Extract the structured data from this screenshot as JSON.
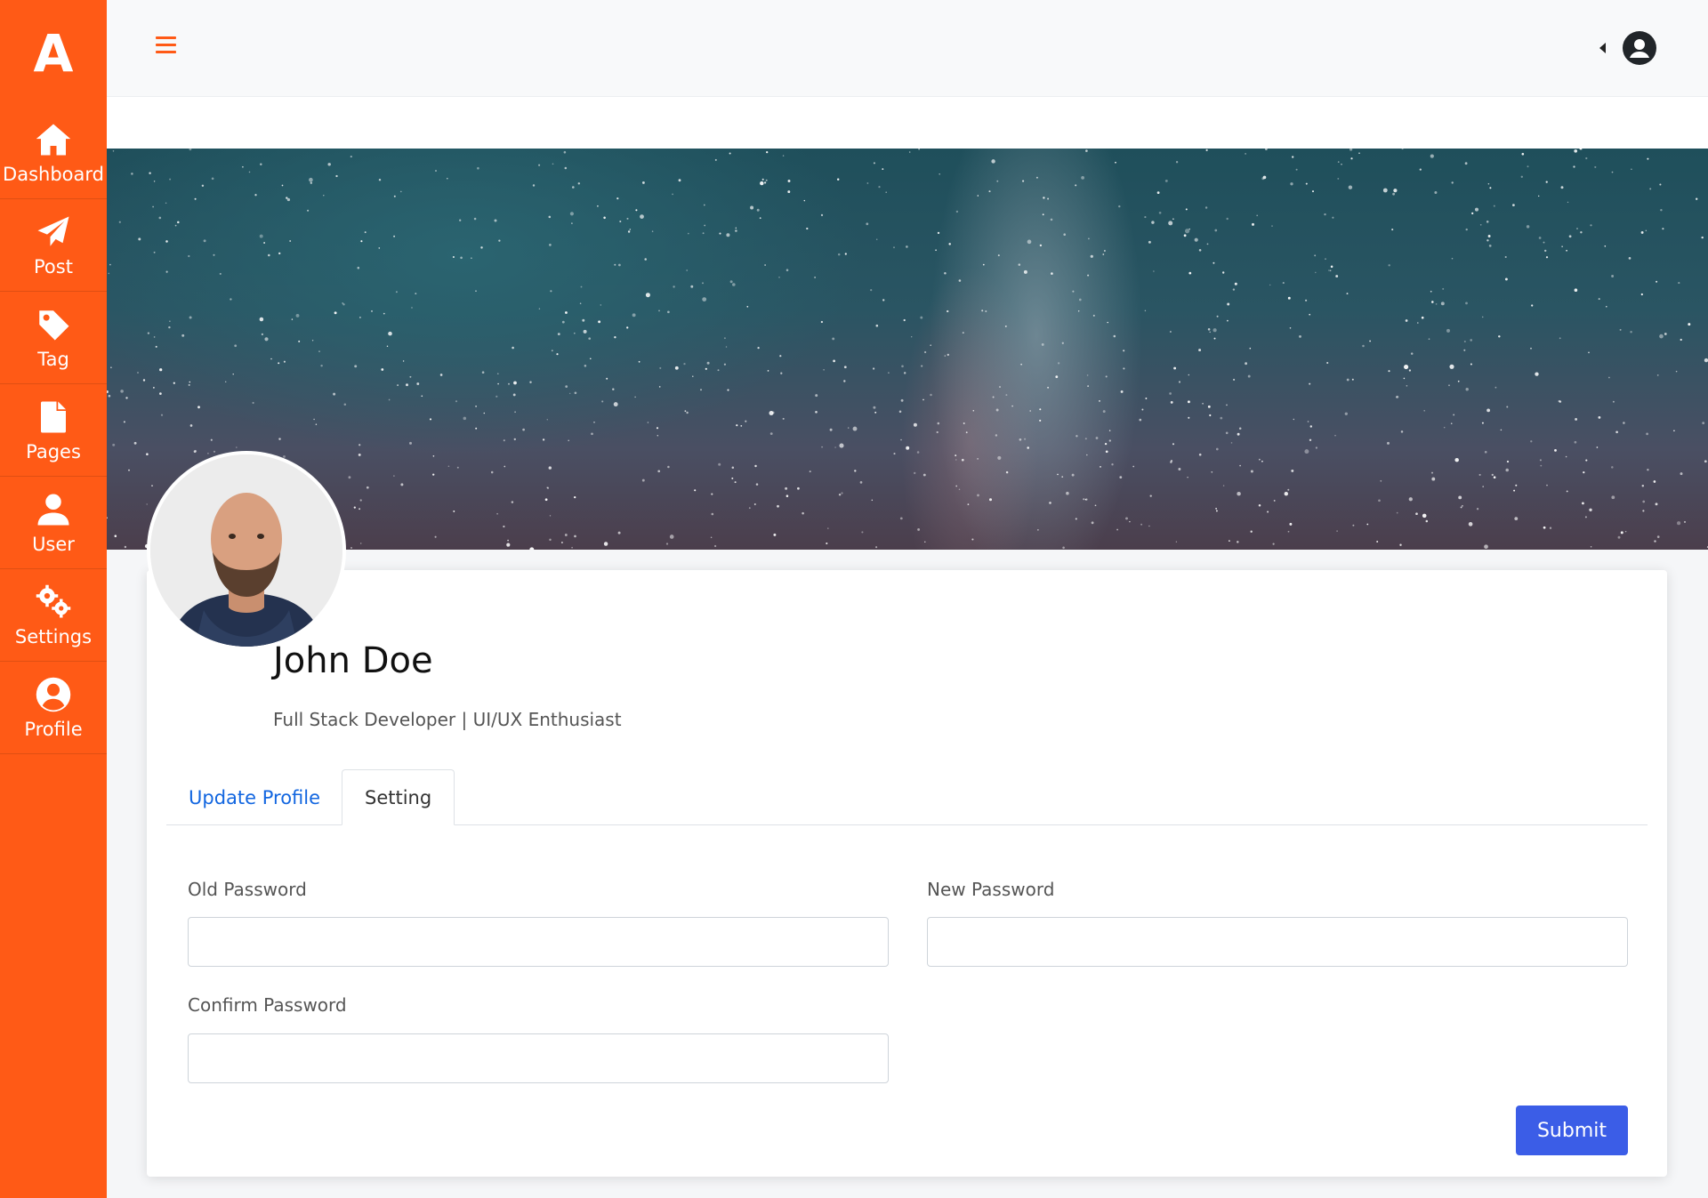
{
  "app": {
    "logo_letter": "A",
    "brand_color": "#ff5a16"
  },
  "sidebar": {
    "items": [
      {
        "label": "Dashboard",
        "icon": "home-icon"
      },
      {
        "label": "Post",
        "icon": "paper-plane-icon"
      },
      {
        "label": "Tag",
        "icon": "tag-icon"
      },
      {
        "label": "Pages",
        "icon": "file-icon"
      },
      {
        "label": "User",
        "icon": "user-icon"
      },
      {
        "label": "Settings",
        "icon": "gears-icon"
      },
      {
        "label": "Profile",
        "icon": "user-circle-icon"
      }
    ]
  },
  "topbar": {
    "menu_icon": "hamburger-icon",
    "dropdown_icon": "caret-left-icon",
    "account_icon": "user-circle-icon"
  },
  "profile": {
    "name": "John Doe",
    "subtitle": "Full Stack Developer | UI/UX Enthusiast"
  },
  "tabs": [
    {
      "label": "Update Profile",
      "active": false
    },
    {
      "label": "Setting",
      "active": true
    }
  ],
  "form": {
    "old_password": {
      "label": "Old Password",
      "value": ""
    },
    "new_password": {
      "label": "New Password",
      "value": ""
    },
    "confirm_password": {
      "label": "Confirm Password",
      "value": ""
    },
    "submit_label": "Submit",
    "submit_color": "#3b5de7"
  }
}
